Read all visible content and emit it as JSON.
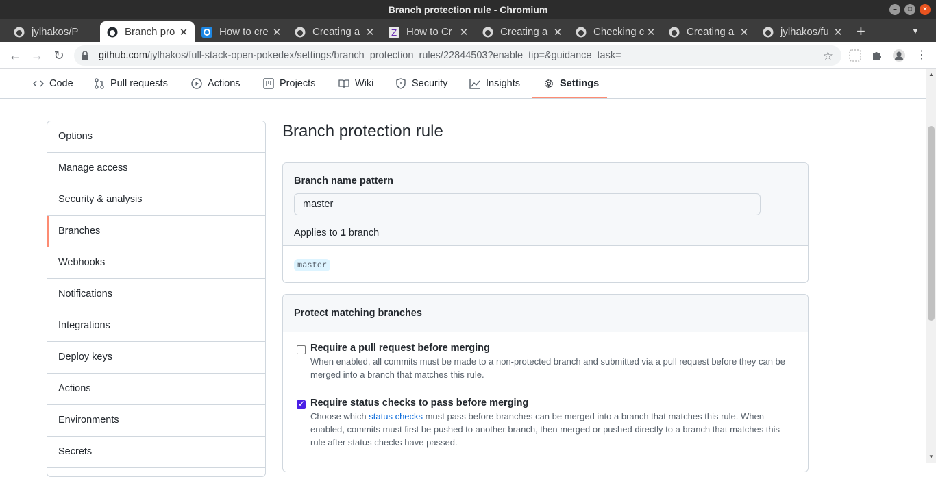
{
  "window": {
    "title": "Branch protection rule - Chromium"
  },
  "tabs": [
    {
      "title": "jylhakos/P",
      "favicon": "github-icon"
    },
    {
      "title": "Branch pro",
      "favicon": "github-icon",
      "active": true
    },
    {
      "title": "How to cre",
      "favicon": "gear-favicon"
    },
    {
      "title": "Creating a",
      "favicon": "github-icon"
    },
    {
      "title": "How to Cr",
      "favicon": "z-favicon"
    },
    {
      "title": "Creating a",
      "favicon": "github-icon"
    },
    {
      "title": "Checking c",
      "favicon": "github-icon"
    },
    {
      "title": "Creating a",
      "favicon": "github-icon"
    },
    {
      "title": "jylhakos/fu",
      "favicon": "github-icon"
    }
  ],
  "address": {
    "host": "github.com",
    "path": "/jylhakos/full-stack-open-pokedex/settings/branch_protection_rules/22844503?enable_tip=&guidance_task="
  },
  "reponav": {
    "code": "Code",
    "pulls": "Pull requests",
    "actions": "Actions",
    "projects": "Projects",
    "wiki": "Wiki",
    "security": "Security",
    "insights": "Insights",
    "settings": "Settings"
  },
  "sidebar": {
    "items": [
      {
        "label": "Options"
      },
      {
        "label": "Manage access"
      },
      {
        "label": "Security & analysis"
      },
      {
        "label": "Branches",
        "selected": true
      },
      {
        "label": "Webhooks"
      },
      {
        "label": "Notifications"
      },
      {
        "label": "Integrations"
      },
      {
        "label": "Deploy keys"
      },
      {
        "label": "Actions"
      },
      {
        "label": "Environments"
      },
      {
        "label": "Secrets"
      }
    ]
  },
  "main": {
    "title": "Branch protection rule",
    "pattern_label": "Branch name pattern",
    "pattern_value": "master",
    "applies_prefix": "Applies to ",
    "applies_count": "1",
    "applies_suffix": " branch",
    "matching_branch": "master",
    "protect_heading": "Protect matching branches",
    "options": [
      {
        "title": "Require a pull request before merging",
        "desc": "When enabled, all commits must be made to a non-protected branch and submitted via a pull request before they can be merged into a branch that matches this rule.",
        "checked": false
      },
      {
        "title": "Require status checks to pass before merging",
        "desc_before": "Choose which ",
        "desc_link": "status checks",
        "desc_after": " must pass before branches can be merged into a branch that matches this rule. When enabled, commits must first be pushed to another branch, then merged or pushed directly to a branch that matches this rule after status checks have passed.",
        "checked": true
      }
    ]
  },
  "colors": {
    "accent": "#fd8c73",
    "link": "#0969da",
    "checkbox": "#4a1fe6"
  }
}
